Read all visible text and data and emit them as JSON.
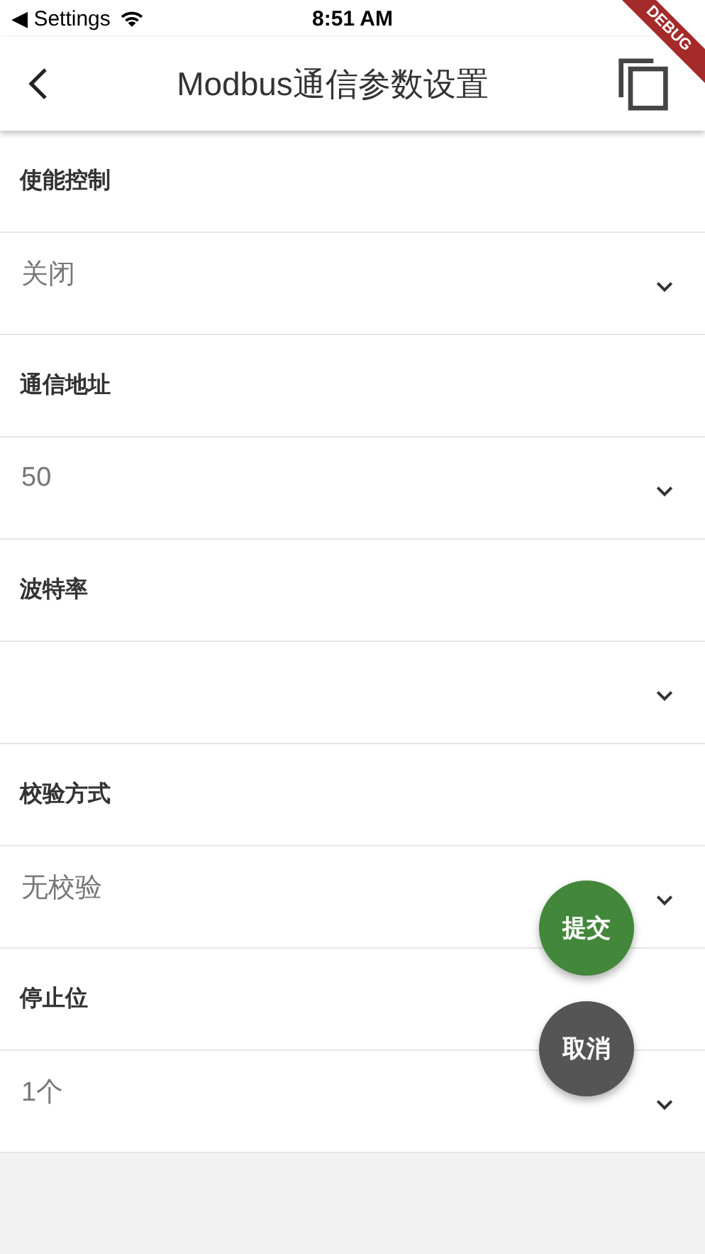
{
  "status_bar": {
    "back_label": "◀ Settings",
    "time": "8:51 AM"
  },
  "debug_banner": "DEBUG",
  "app_bar": {
    "title": "Modbus通信参数设置"
  },
  "fields": [
    {
      "label": "使能控制",
      "value": "关闭"
    },
    {
      "label": "通信地址",
      "value": "50"
    },
    {
      "label": "波特率"
    },
    {
      "label": "校验方式",
      "value": "无校验"
    },
    {
      "label": "停止位",
      "value": "1个"
    }
  ],
  "buttons": [
    {
      "label": "提交",
      "kind": "primary"
    },
    {
      "label": "取消",
      "kind": "secondary"
    }
  ]
}
